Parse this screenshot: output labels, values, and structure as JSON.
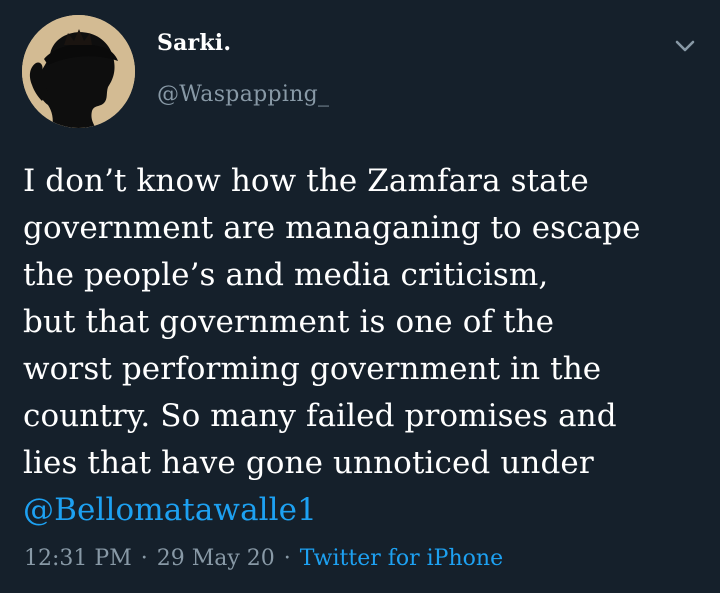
{
  "tweet": {
    "author": {
      "display_name": "Sarki.",
      "handle": "@Waspapping_",
      "avatar_icon": "profile-silhouette-crown"
    },
    "menu_icon": "chevron-down-icon",
    "text_lines": [
      "I don’t know how the Zamfara state",
      "government are managaning to escape",
      "the people’s and media criticism,",
      "but that government is one of the",
      "worst performing government in the",
      "country. So many failed promises and",
      "lies that have gone unnoticed under"
    ],
    "mention": "@Bellomatawalle1",
    "time": "12:31 PM",
    "date": "29 May 20",
    "separator": "·",
    "source": "Twitter for iPhone"
  },
  "colors": {
    "background": "#15202b",
    "text": "#ffffff",
    "secondary": "#8899a6",
    "link": "#1da1f2"
  }
}
